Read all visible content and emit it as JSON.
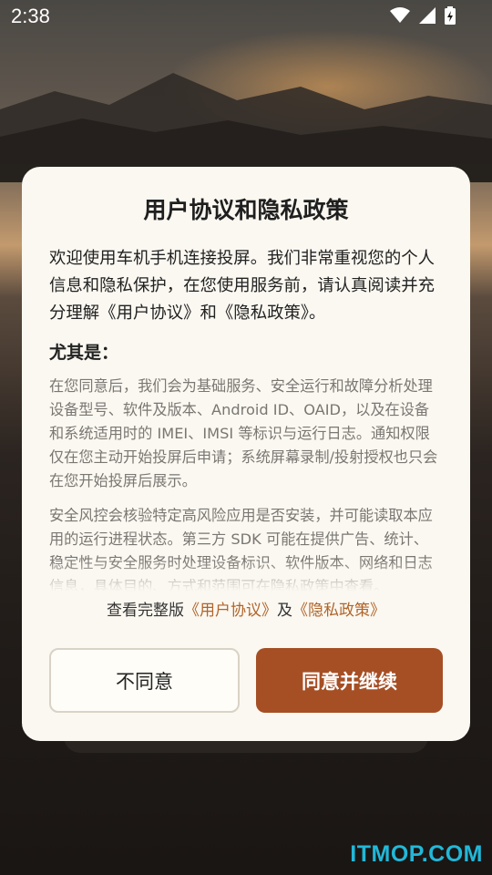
{
  "status_bar": {
    "time": "2:38",
    "icons": [
      "wifi-icon",
      "cell-signal-icon",
      "battery-charging-icon"
    ]
  },
  "dialog": {
    "title": "用户协议和隐私政策",
    "intro": "欢迎使用车机手机连接投屏。我们非常重视您的个人信息和隐私保护，在您使用服务前，请认真阅读并充分理解《用户协议》和《隐私政策》。",
    "emphasis": "尤其是：",
    "paragraphs": [
      "在您同意后，我们会为基础服务、安全运行和故障分析处理设备型号、软件及版本、Android ID、OAID，以及在设备和系统适用时的 IMEI、IMSI 等标识与运行日志。通知权限仅在您主动开始投屏后申请；系统屏幕录制/投射授权也只会在您开始投屏后展示。",
      "安全风控会核验特定高风险应用是否安装，并可能读取本应用的运行进程状态。第三方 SDK 可能在提供广告、统计、稳定性与安全服务时处理设备标识、软件版本、网络和日志信息，具体目的、方式和范围可在隐私政策中查看。"
    ],
    "links_prefix": "查看完整版",
    "link_agreement": "《用户协议》",
    "links_and": "及",
    "link_privacy": "《隐私政策》",
    "decline_label": "不同意",
    "accept_label": "同意并继续"
  },
  "watermark": "ITMOP.COM",
  "colors": {
    "accent": "#a64f24",
    "link": "#b0642a",
    "dialog_bg": "#fbf8f1",
    "watermark": "#22b8d8"
  }
}
